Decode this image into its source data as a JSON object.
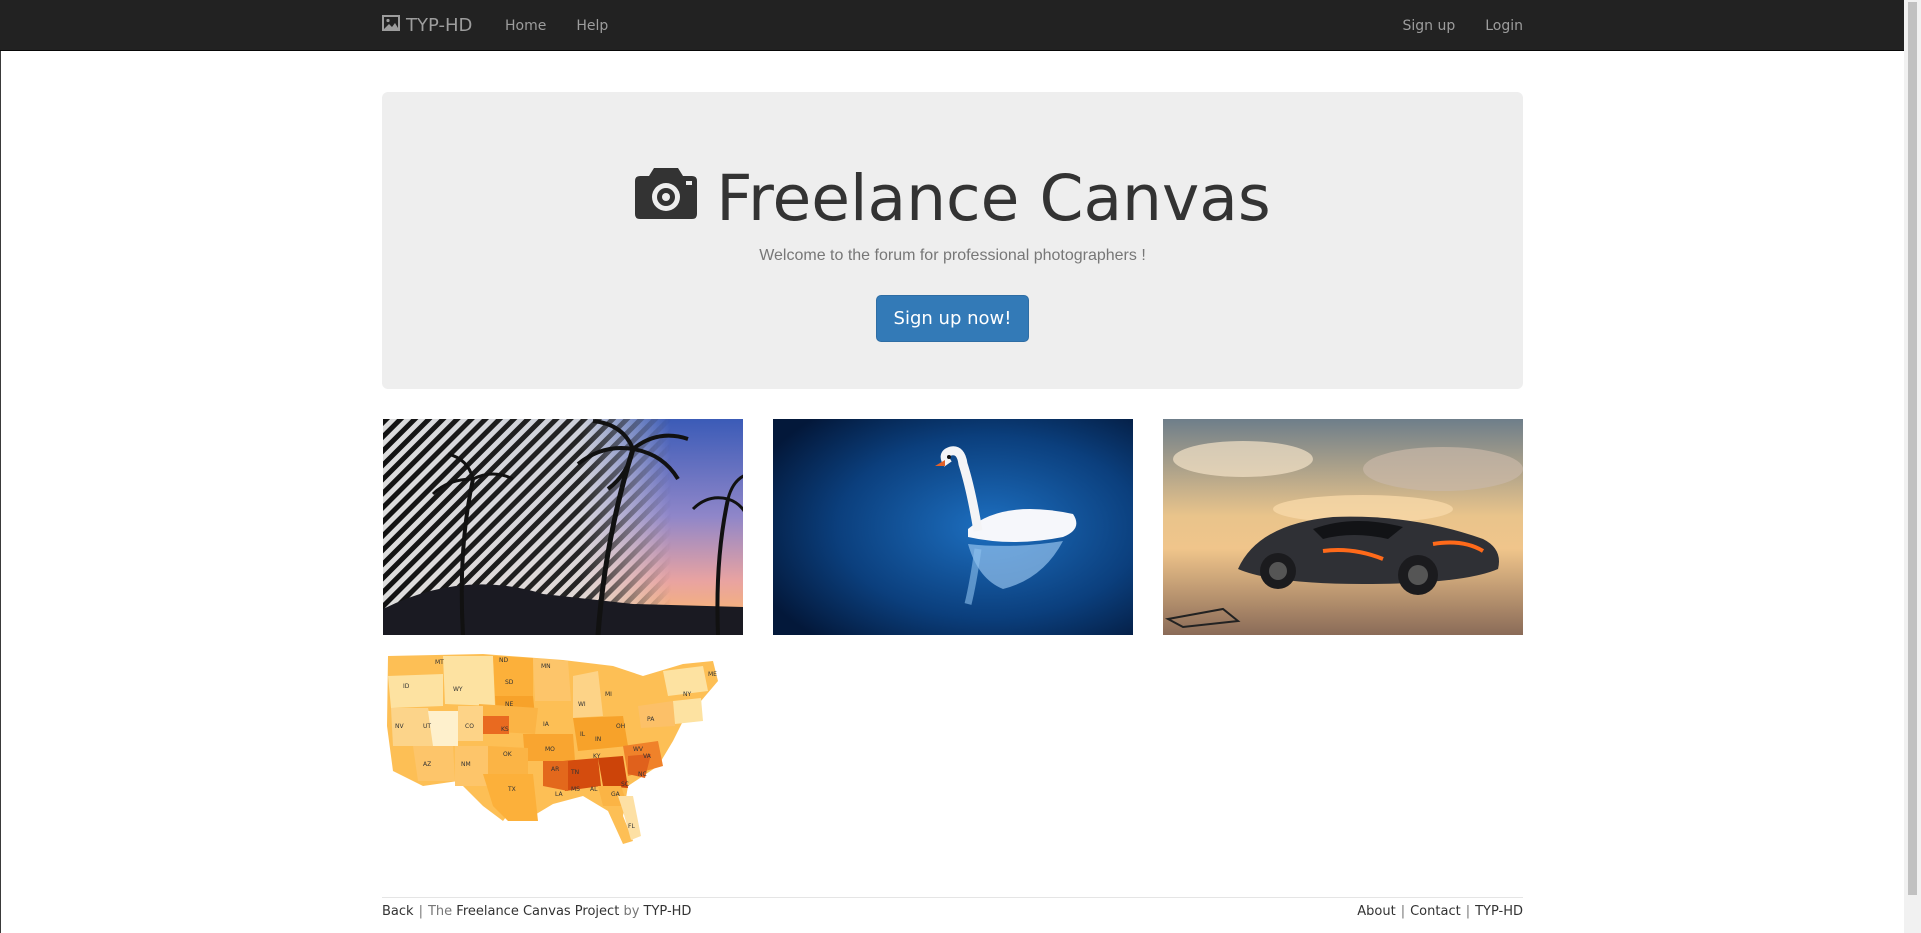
{
  "navbar": {
    "brand": "TYP-HD",
    "brand_icon": "picture-icon",
    "links_left": [
      {
        "label": "Home"
      },
      {
        "label": "Help"
      }
    ],
    "links_right": [
      {
        "label": "Sign up"
      },
      {
        "label": "Login"
      }
    ]
  },
  "hero": {
    "icon": "camera-icon",
    "title": "Freelance Canvas",
    "subtitle": "Welcome to the forum for professional photographers !",
    "cta_label": "Sign up now!"
  },
  "gallery": [
    {
      "name": "palm-trees-sunset-image"
    },
    {
      "name": "swan-image"
    },
    {
      "name": "sports-car-image"
    },
    {
      "name": "us-map-image"
    }
  ],
  "footer": {
    "back": "Back",
    "project_prefix": "The",
    "project_name": "Freelance Canvas Project",
    "by": "by",
    "author": "TYP-HD",
    "links": [
      {
        "label": "About"
      },
      {
        "label": "Contact"
      },
      {
        "label": "TYP-HD"
      }
    ]
  },
  "colors": {
    "navbar_bg": "#222222",
    "nav_text": "#9d9d9d",
    "jumbotron_bg": "#eeeeee",
    "primary_button": "#337ab7"
  }
}
